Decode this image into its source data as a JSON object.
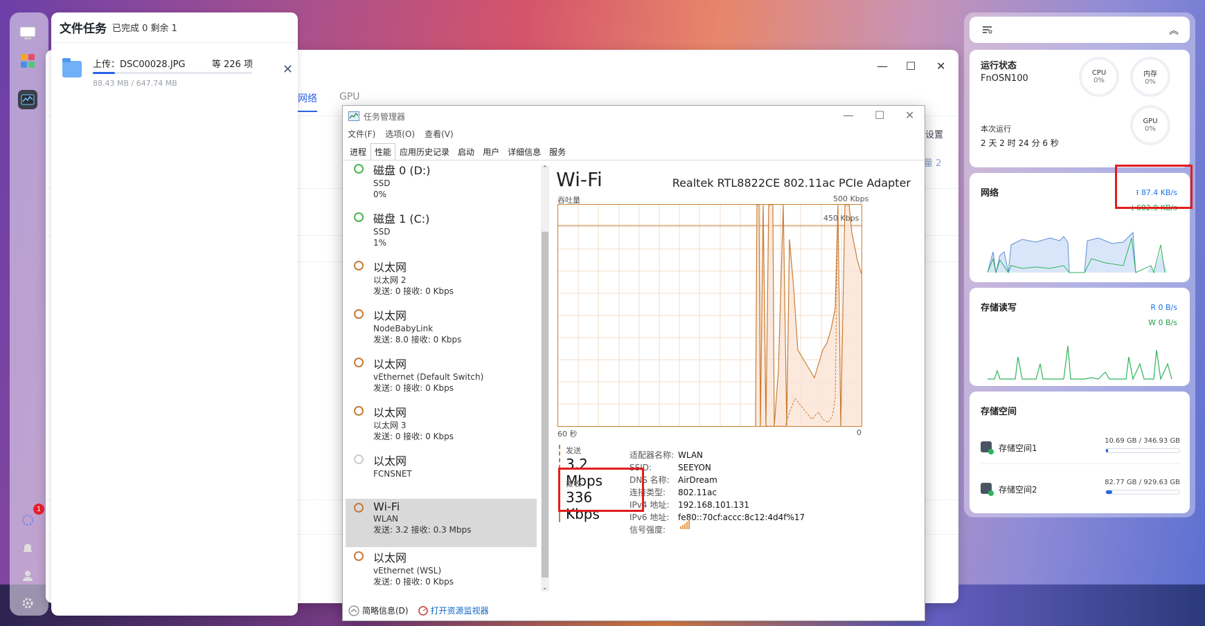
{
  "file_task": {
    "title": "文件任务",
    "summary": "已完成 0 剩余 1",
    "item": {
      "name": "上传：DSC00028.JPG",
      "count": "等 226 项",
      "size": "88.43 MB / 647.74 MB",
      "progress": 0.137
    }
  },
  "monitor_window": {
    "tabs": [
      {
        "label": "网络"
      },
      {
        "label": "GPU"
      }
    ],
    "side_text_1": "设置",
    "side_text_2": "量 2"
  },
  "task_manager": {
    "title": "任务管理器",
    "menu": [
      "文件(F)",
      "选项(O)",
      "查看(V)"
    ],
    "tabs": [
      "进程",
      "性能",
      "应用历史记录",
      "启动",
      "用户",
      "详细信息",
      "服务"
    ],
    "devices": [
      {
        "name": "磁盘 0 (D:)",
        "sub": "SSD",
        "detail": "0%",
        "ring": "g"
      },
      {
        "name": "磁盘 1 (C:)",
        "sub": "SSD",
        "detail": "1%",
        "ring": "g"
      },
      {
        "name": "以太网",
        "sub": "以太网 2",
        "detail": "发送: 0 接收: 0 Kbps",
        "ring": "o"
      },
      {
        "name": "以太网",
        "sub": "NodeBabyLink",
        "detail": "发送: 8.0 接收: 0 Kbps",
        "ring": "o"
      },
      {
        "name": "以太网",
        "sub": "vEthernet (Default Switch)",
        "detail": "发送: 0 接收: 0 Kbps",
        "ring": "o"
      },
      {
        "name": "以太网",
        "sub": "以太网 3",
        "detail": "发送: 0 接收: 0 Kbps",
        "ring": "o"
      },
      {
        "name": "以太网",
        "sub": "FCNSNET",
        "detail": "",
        "ring": "x"
      },
      {
        "name": "Wi-Fi",
        "sub": "WLAN",
        "detail": "发送: 3.2 接收: 0.3 Mbps",
        "ring": "o",
        "selected": true
      },
      {
        "name": "以太网",
        "sub": "vEthernet (WSL)",
        "detail": "发送: 0 接收: 0 Kbps",
        "ring": "o"
      }
    ],
    "heading": "Wi-Fi",
    "adapter": "Realtek RTL8822CE 802.11ac PCIe Adapter",
    "graph": {
      "y_label": "吞吐量",
      "y_max": "500 Kbps",
      "y_mark": "450 Kbps",
      "x_left": "60 秒",
      "x_right": "0"
    },
    "send_label": "发送",
    "send_value": "3.2 Mbps",
    "recv_label": "接收",
    "recv_value": "336 Kbps",
    "info": [
      {
        "k": "适配器名称:",
        "v": "WLAN"
      },
      {
        "k": "SSID:",
        "v": "SEEYON"
      },
      {
        "k": "DNS 名称:",
        "v": "AirDream"
      },
      {
        "k": "连接类型:",
        "v": "802.11ac"
      },
      {
        "k": "IPv4 地址:",
        "v": "192.168.101.131"
      },
      {
        "k": "IPv6 地址:",
        "v": "fe80::70cf:accc:8c12:4d4f%17"
      },
      {
        "k": "信号强度:",
        "v": ""
      }
    ],
    "footer": {
      "brief": "简略信息(D)",
      "resmon": "打开资源监视器"
    }
  },
  "widgets": {
    "status": {
      "title": "运行状态",
      "host": "FnOSN100",
      "uptime_label": "本次运行",
      "uptime": "2 天 2 时 24 分 6 秒",
      "cpu": {
        "label": "CPU",
        "value": "0%"
      },
      "mem": {
        "label": "内存",
        "value": "0%"
      },
      "gpu": {
        "label": "GPU",
        "value": "0%"
      }
    },
    "network": {
      "title": "网络",
      "up": "87.4 KB/s",
      "down": "602.9 KB/s"
    },
    "storage_io": {
      "title": "存储读写",
      "read": "R  0 B/s",
      "write": "W  0 B/s"
    },
    "storage": {
      "title": "存储空间",
      "items": [
        {
          "name": "存储空间1",
          "size": "10.69 GB / 346.93 GB",
          "ratio": 0.031
        },
        {
          "name": "存储空间2",
          "size": "82.77 GB / 929.63 GB",
          "ratio": 0.089
        }
      ]
    }
  },
  "notifications": {
    "badge": "1"
  }
}
